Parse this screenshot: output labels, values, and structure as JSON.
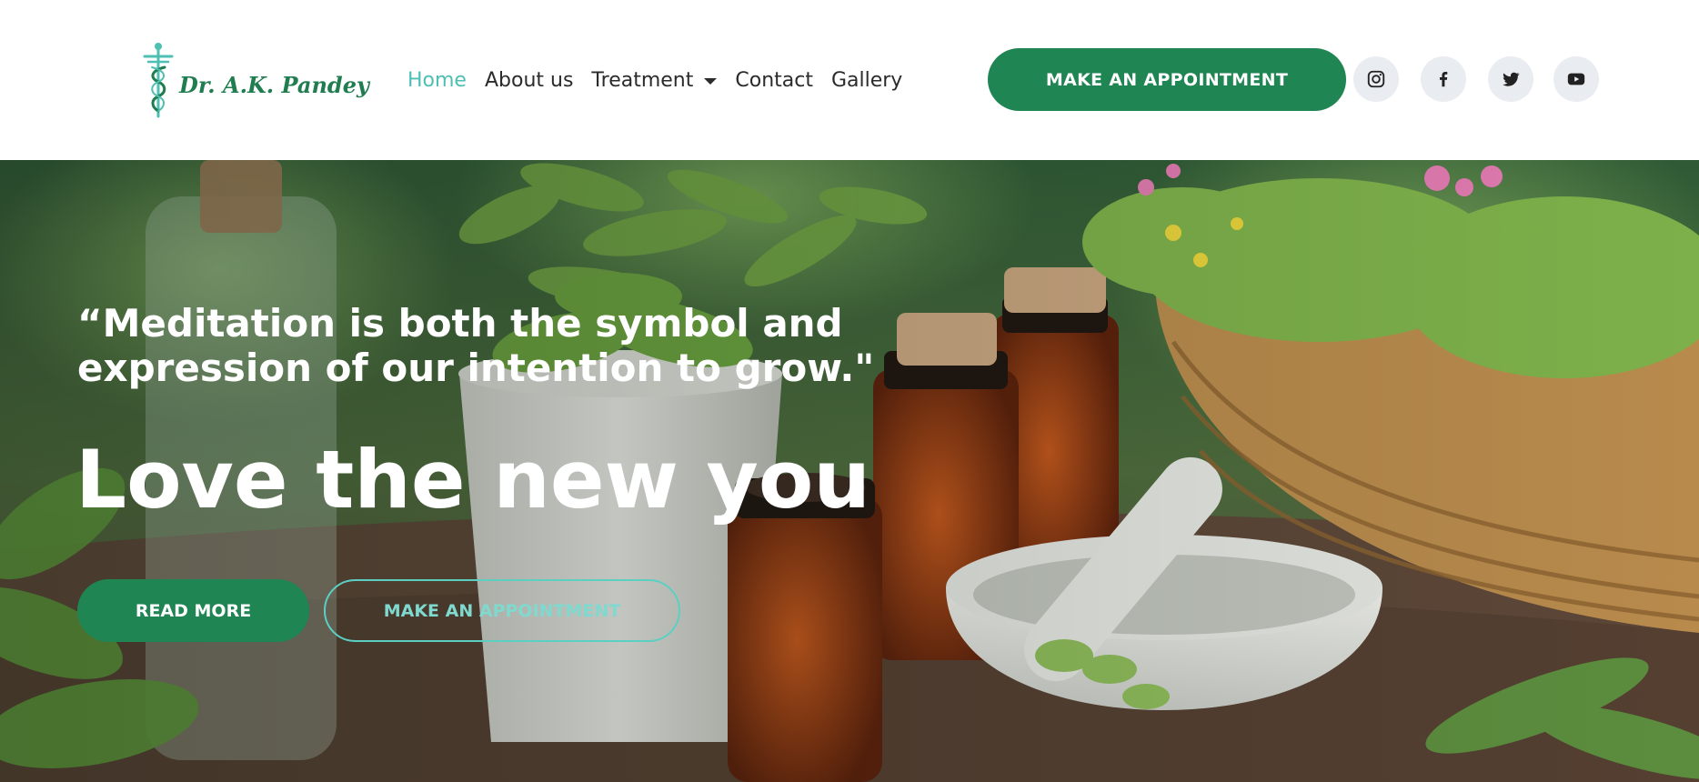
{
  "brand": {
    "name": "Dr. A.K. Pandey",
    "accent": "#4fbfb3",
    "primary": "#1f8553"
  },
  "nav": {
    "items": [
      {
        "label": "Home",
        "active": true
      },
      {
        "label": "About us"
      },
      {
        "label": "Treatment",
        "dropdown": true
      },
      {
        "label": "Contact"
      },
      {
        "label": "Gallery"
      }
    ]
  },
  "header": {
    "cta_label": "MAKE AN APPOINTMENT",
    "social": [
      {
        "icon": "instagram-icon"
      },
      {
        "icon": "facebook-icon"
      },
      {
        "icon": "twitter-icon"
      },
      {
        "icon": "youtube-icon"
      }
    ]
  },
  "hero": {
    "quote": "“Meditation is both the symbol and expression of our intention to grow.\"",
    "headline": "Love the new you",
    "read_more_label": "READ MORE",
    "appointment_label": "MAKE AN APPOINTMENT"
  }
}
